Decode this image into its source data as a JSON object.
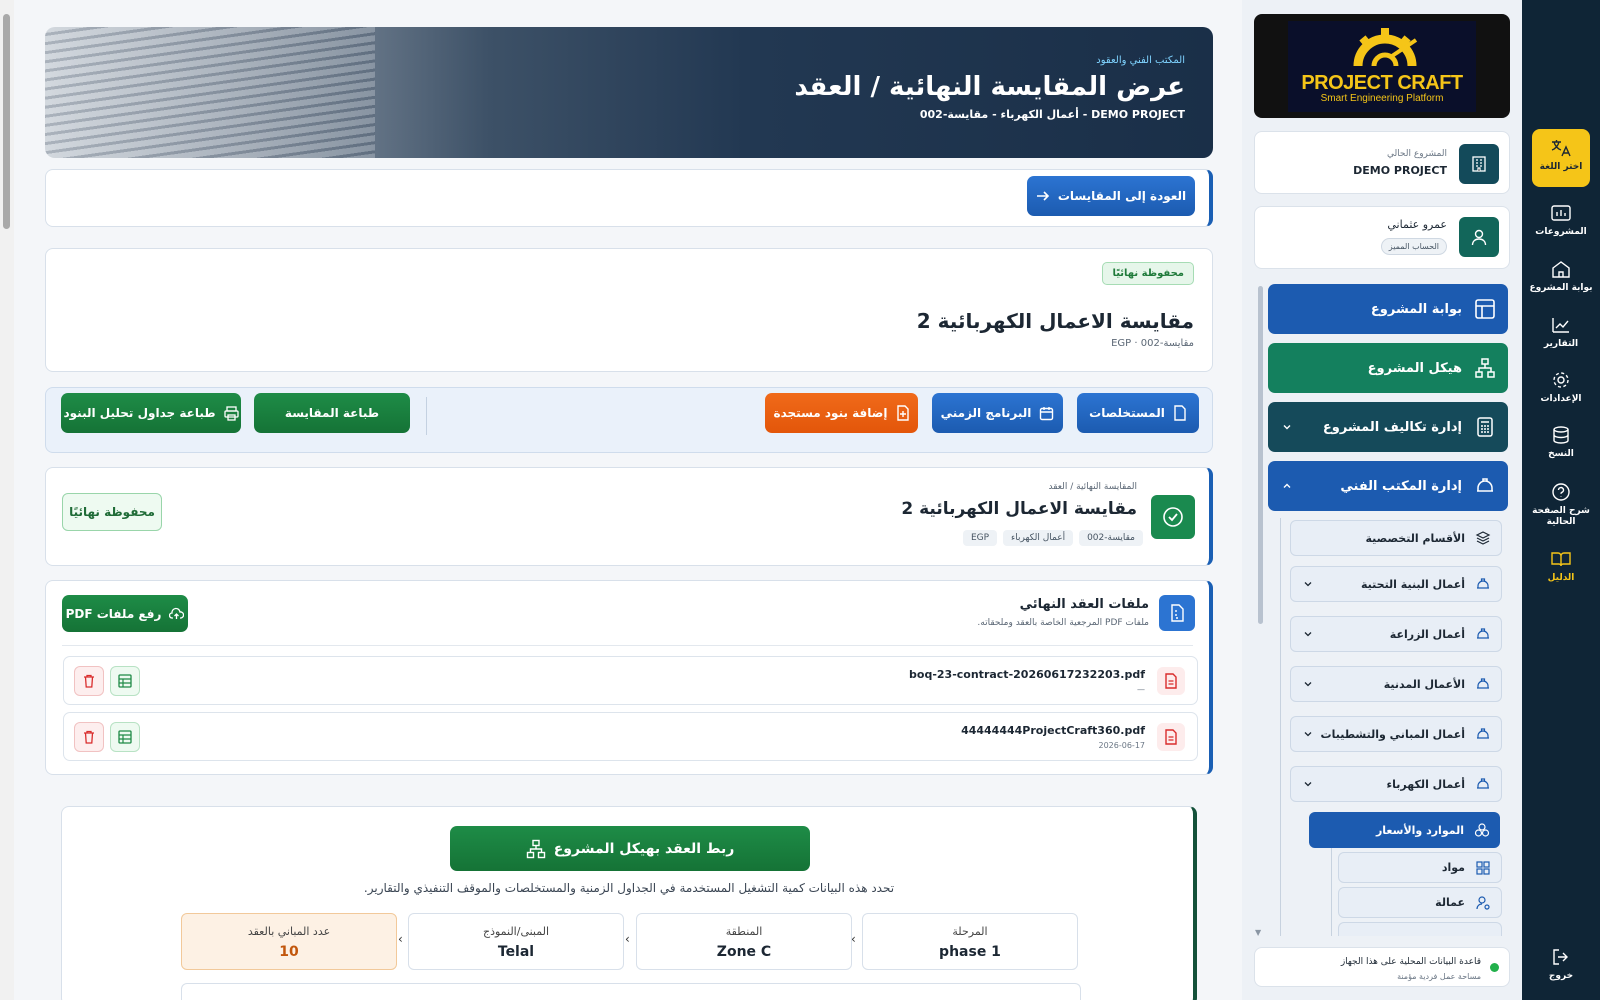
{
  "hero": {
    "kicker": "المكتب الفني والعقود",
    "title": "عرض المقايسة النهائية / العقد",
    "subtitle": "DEMO PROJECT - أعمال الكهرباء - مقايسة-002"
  },
  "back_button": "العودة إلى المقايسات",
  "summary": {
    "status": "محفوظة نهائيًا",
    "title": "مقايسة الاعمال الكهربائية 2",
    "meta": "مقايسة-002 · EGP"
  },
  "actions": {
    "payments": "المستخلصات",
    "schedule": "البرنامج الزمني",
    "add_items": "إضافة بنود مستجدة",
    "print_boq": "طباعة المقايسة",
    "print_analysis": "طباعة جداول تحليل البنود"
  },
  "contract": {
    "breadcrumb": "المقايسة النهائية / العقد",
    "title": "مقايسة الاعمال الكهربائية 2",
    "chips": [
      "مقايسة-002",
      "أعمال الكهرباء",
      "EGP"
    ],
    "status_button": "محفوظة نهائيًا"
  },
  "files": {
    "title": "ملفات العقد النهائي",
    "subtitle": "ملفات PDF المرجعية الخاصة بالعقد وملحقاته.",
    "upload_button": "رفع ملفات PDF",
    "items": [
      {
        "name": "boq-23-contract-20260617232203.pdf",
        "date": "—"
      },
      {
        "name": "44444444ProjectCraft360.pdf",
        "date": "2026-06-17"
      }
    ]
  },
  "structure": {
    "link_button": "ربط العقد بهيكل المشروع",
    "description": "تحدد هذه البيانات كمية التشغيل المستخدمة في الجداول الزمنية والمستخلصات والموقف التنفيذي والتقارير.",
    "boxes": [
      {
        "label": "المرحلة",
        "value": "phase 1"
      },
      {
        "label": "المنطقة",
        "value": "Zone C"
      },
      {
        "label": "المبنى/النموذج",
        "value": "Telal"
      },
      {
        "label": "عدد المباني بالعقد",
        "value": "10"
      }
    ]
  },
  "sidebar": {
    "logo_title": "PROJECT CRAFT",
    "logo_sub": "Smart Engineering Platform",
    "project_label": "المشروع الحالي",
    "project_name": "DEMO PROJECT",
    "user_name": "عمرو عثماني",
    "user_badge": "الحساب المميز",
    "nav": [
      {
        "label": "بوابة المشروع",
        "color": "#1c5bb0"
      },
      {
        "label": "هيكل المشروع",
        "color": "#14805e"
      },
      {
        "label": "إدارة تكاليف المشروع",
        "color": "#154a5a"
      },
      {
        "label": "إدارة المكتب الفني",
        "color": "#1c5bb0"
      }
    ],
    "sub_nav": [
      "الأقسام التخصصية",
      "أعمال البنية التحتية",
      "أعمال الزراعة",
      "الأعمال المدنية",
      "أعمال المباني والتشطيبات",
      "أعمال الكهرباء"
    ],
    "resources": "الموارد والأسعار",
    "resource_items": [
      "مواد",
      "عمالة"
    ],
    "db_status": "قاعدة البيانات المحلية على هذا الجهاز",
    "db_sub": "مساحة عمل فردية مؤمنة"
  },
  "rail": {
    "language": "اختر اللغة",
    "projects": "المشروعات",
    "portal": "بوابة المشروع",
    "reports": "التقارير",
    "settings": "الإعدادات",
    "backup": "النسخ",
    "help": "شرح الصفحة الحالية",
    "guide": "الدليل",
    "logout": "خروج"
  },
  "colors": {
    "primary": "#1c5bb0",
    "success": "#1e8c47",
    "orange": "#e3560a",
    "rail": "#0f2536",
    "accent_yellow": "#f5c518"
  }
}
